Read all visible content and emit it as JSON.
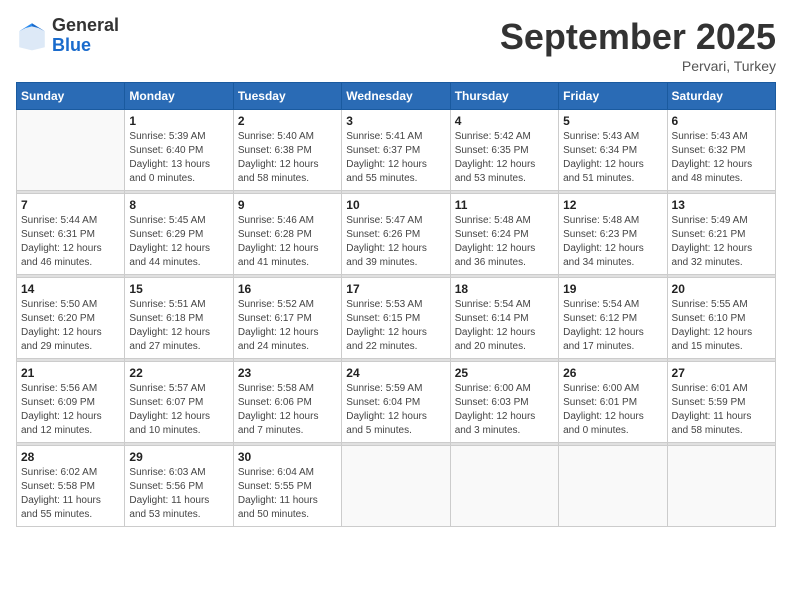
{
  "header": {
    "logo_general": "General",
    "logo_blue": "Blue",
    "month": "September 2025",
    "location": "Pervari, Turkey"
  },
  "weekdays": [
    "Sunday",
    "Monday",
    "Tuesday",
    "Wednesday",
    "Thursday",
    "Friday",
    "Saturday"
  ],
  "weeks": [
    [
      {
        "day": "",
        "info": ""
      },
      {
        "day": "1",
        "info": "Sunrise: 5:39 AM\nSunset: 6:40 PM\nDaylight: 13 hours\nand 0 minutes."
      },
      {
        "day": "2",
        "info": "Sunrise: 5:40 AM\nSunset: 6:38 PM\nDaylight: 12 hours\nand 58 minutes."
      },
      {
        "day": "3",
        "info": "Sunrise: 5:41 AM\nSunset: 6:37 PM\nDaylight: 12 hours\nand 55 minutes."
      },
      {
        "day": "4",
        "info": "Sunrise: 5:42 AM\nSunset: 6:35 PM\nDaylight: 12 hours\nand 53 minutes."
      },
      {
        "day": "5",
        "info": "Sunrise: 5:43 AM\nSunset: 6:34 PM\nDaylight: 12 hours\nand 51 minutes."
      },
      {
        "day": "6",
        "info": "Sunrise: 5:43 AM\nSunset: 6:32 PM\nDaylight: 12 hours\nand 48 minutes."
      }
    ],
    [
      {
        "day": "7",
        "info": "Sunrise: 5:44 AM\nSunset: 6:31 PM\nDaylight: 12 hours\nand 46 minutes."
      },
      {
        "day": "8",
        "info": "Sunrise: 5:45 AM\nSunset: 6:29 PM\nDaylight: 12 hours\nand 44 minutes."
      },
      {
        "day": "9",
        "info": "Sunrise: 5:46 AM\nSunset: 6:28 PM\nDaylight: 12 hours\nand 41 minutes."
      },
      {
        "day": "10",
        "info": "Sunrise: 5:47 AM\nSunset: 6:26 PM\nDaylight: 12 hours\nand 39 minutes."
      },
      {
        "day": "11",
        "info": "Sunrise: 5:48 AM\nSunset: 6:24 PM\nDaylight: 12 hours\nand 36 minutes."
      },
      {
        "day": "12",
        "info": "Sunrise: 5:48 AM\nSunset: 6:23 PM\nDaylight: 12 hours\nand 34 minutes."
      },
      {
        "day": "13",
        "info": "Sunrise: 5:49 AM\nSunset: 6:21 PM\nDaylight: 12 hours\nand 32 minutes."
      }
    ],
    [
      {
        "day": "14",
        "info": "Sunrise: 5:50 AM\nSunset: 6:20 PM\nDaylight: 12 hours\nand 29 minutes."
      },
      {
        "day": "15",
        "info": "Sunrise: 5:51 AM\nSunset: 6:18 PM\nDaylight: 12 hours\nand 27 minutes."
      },
      {
        "day": "16",
        "info": "Sunrise: 5:52 AM\nSunset: 6:17 PM\nDaylight: 12 hours\nand 24 minutes."
      },
      {
        "day": "17",
        "info": "Sunrise: 5:53 AM\nSunset: 6:15 PM\nDaylight: 12 hours\nand 22 minutes."
      },
      {
        "day": "18",
        "info": "Sunrise: 5:54 AM\nSunset: 6:14 PM\nDaylight: 12 hours\nand 20 minutes."
      },
      {
        "day": "19",
        "info": "Sunrise: 5:54 AM\nSunset: 6:12 PM\nDaylight: 12 hours\nand 17 minutes."
      },
      {
        "day": "20",
        "info": "Sunrise: 5:55 AM\nSunset: 6:10 PM\nDaylight: 12 hours\nand 15 minutes."
      }
    ],
    [
      {
        "day": "21",
        "info": "Sunrise: 5:56 AM\nSunset: 6:09 PM\nDaylight: 12 hours\nand 12 minutes."
      },
      {
        "day": "22",
        "info": "Sunrise: 5:57 AM\nSunset: 6:07 PM\nDaylight: 12 hours\nand 10 minutes."
      },
      {
        "day": "23",
        "info": "Sunrise: 5:58 AM\nSunset: 6:06 PM\nDaylight: 12 hours\nand 7 minutes."
      },
      {
        "day": "24",
        "info": "Sunrise: 5:59 AM\nSunset: 6:04 PM\nDaylight: 12 hours\nand 5 minutes."
      },
      {
        "day": "25",
        "info": "Sunrise: 6:00 AM\nSunset: 6:03 PM\nDaylight: 12 hours\nand 3 minutes."
      },
      {
        "day": "26",
        "info": "Sunrise: 6:00 AM\nSunset: 6:01 PM\nDaylight: 12 hours\nand 0 minutes."
      },
      {
        "day": "27",
        "info": "Sunrise: 6:01 AM\nSunset: 5:59 PM\nDaylight: 11 hours\nand 58 minutes."
      }
    ],
    [
      {
        "day": "28",
        "info": "Sunrise: 6:02 AM\nSunset: 5:58 PM\nDaylight: 11 hours\nand 55 minutes."
      },
      {
        "day": "29",
        "info": "Sunrise: 6:03 AM\nSunset: 5:56 PM\nDaylight: 11 hours\nand 53 minutes."
      },
      {
        "day": "30",
        "info": "Sunrise: 6:04 AM\nSunset: 5:55 PM\nDaylight: 11 hours\nand 50 minutes."
      },
      {
        "day": "",
        "info": ""
      },
      {
        "day": "",
        "info": ""
      },
      {
        "day": "",
        "info": ""
      },
      {
        "day": "",
        "info": ""
      }
    ]
  ]
}
